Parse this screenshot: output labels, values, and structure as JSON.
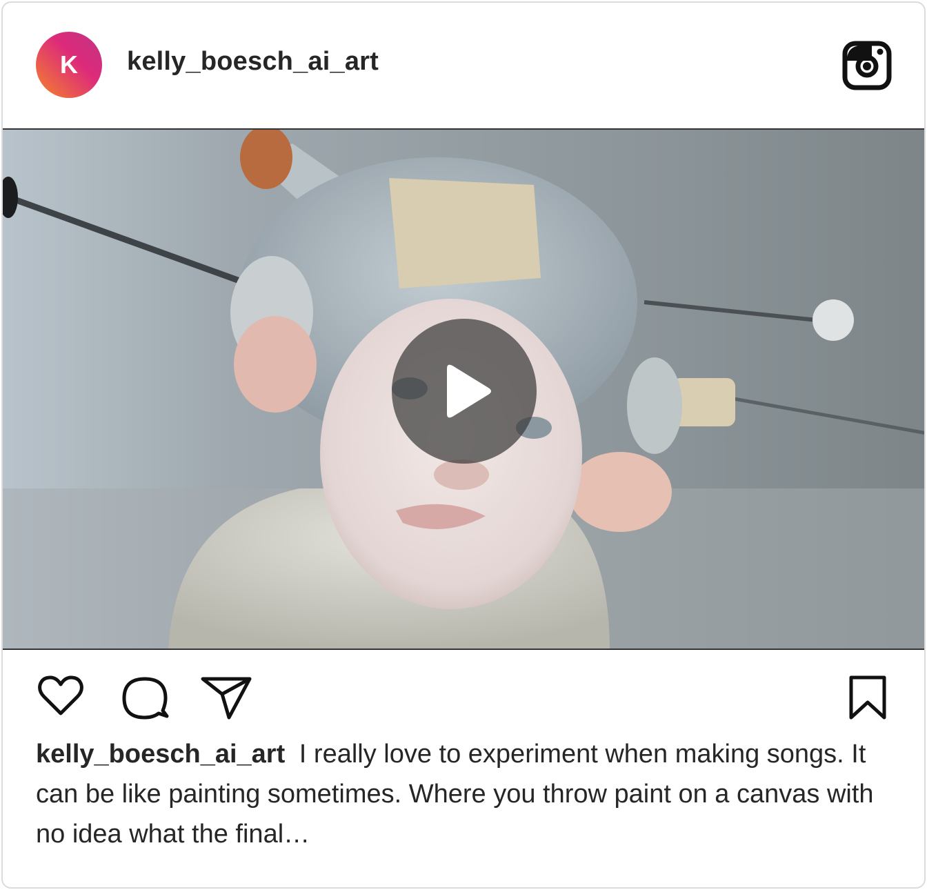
{
  "post": {
    "avatar_initial": "K",
    "username": "kelly_boesch_ai_art",
    "caption_username": "kelly_boesch_ai_art",
    "caption_text": "I really love to experiment when making songs. It can be like painting sometimes. Where you throw paint on a canvas with no idea what the final…",
    "media_type": "video",
    "icons": {
      "brand": "instagram-icon",
      "like": "heart-icon",
      "comment": "comment-icon",
      "share": "send-icon",
      "save": "bookmark-icon",
      "play": "play-icon"
    }
  },
  "colors": {
    "avatar_gradient": [
      "#f58529",
      "#dd2a7b",
      "#c13584"
    ],
    "text": "#262626",
    "border": "#dbdbdb"
  }
}
